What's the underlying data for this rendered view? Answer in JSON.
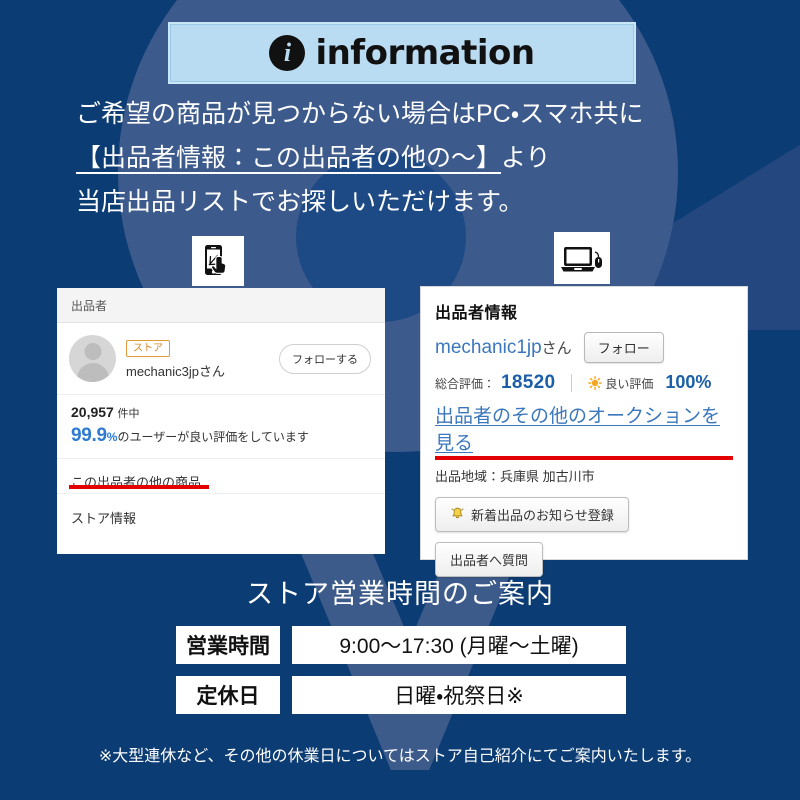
{
  "theme": {
    "bg_navy": "#0c3c74",
    "header_bg": "#b9dcf2",
    "accent_red": "#e30000",
    "link_blue": "#3b77bd",
    "rating_blue": "#2e7bd1",
    "badge_orange": "#d98526"
  },
  "header": {
    "icon": "information-circle-icon",
    "title": "information"
  },
  "lead": {
    "line1": "ご希望の商品が見つからない場合はPC・スマホ共に",
    "line2": "【出品者情報：この出品者の他の〜】",
    "line2_suffix": "より",
    "line3": "当店出品リストでお探しいただけます。"
  },
  "devices": {
    "phone_icon": "smartphone-tap-icon",
    "pc_icon": "laptop-mouse-icon"
  },
  "sp_card": {
    "section_header": "出品者",
    "badge": "ストア",
    "seller_name": "mechanic3jpさん",
    "follow_button": "フォローする",
    "rating_count": "20,957",
    "rating_count_unit": "件中",
    "rating_percent": "99.9",
    "rating_percent_symbol": "%",
    "rating_text": "のユーザーが良い評価をしています",
    "other_items_link": "この出品者の他の商品",
    "store_info_link": "ストア情報"
  },
  "pc_card": {
    "title": "出品者情報",
    "seller_name": "mechanic1jp",
    "seller_suffix": "さん",
    "follow_button": "フォロー",
    "total_rating_label": "総合評価：",
    "total_rating_value": "18520",
    "good_rating_icon": "sun-icon",
    "good_rating_label": "良い評価",
    "good_rating_value": "100%",
    "auctions_link": "出品者のその他のオークションを見る",
    "area_label": "出品地域：兵庫県 加古川市",
    "notify_button_icon": "bell-icon",
    "notify_button": "新着出品のお知らせ登録",
    "question_button": "出品者へ質問"
  },
  "hours": {
    "title": "ストア営業時間のご案内",
    "rows": [
      {
        "label": "営業時間",
        "value": "9:00〜17:30 (月曜〜土曜)"
      },
      {
        "label": "定休日",
        "value": "日曜・祝祭日※"
      }
    ]
  },
  "footnote": "※大型連休など、その他の休業日についてはストア自己紹介にてご案内いたします。"
}
